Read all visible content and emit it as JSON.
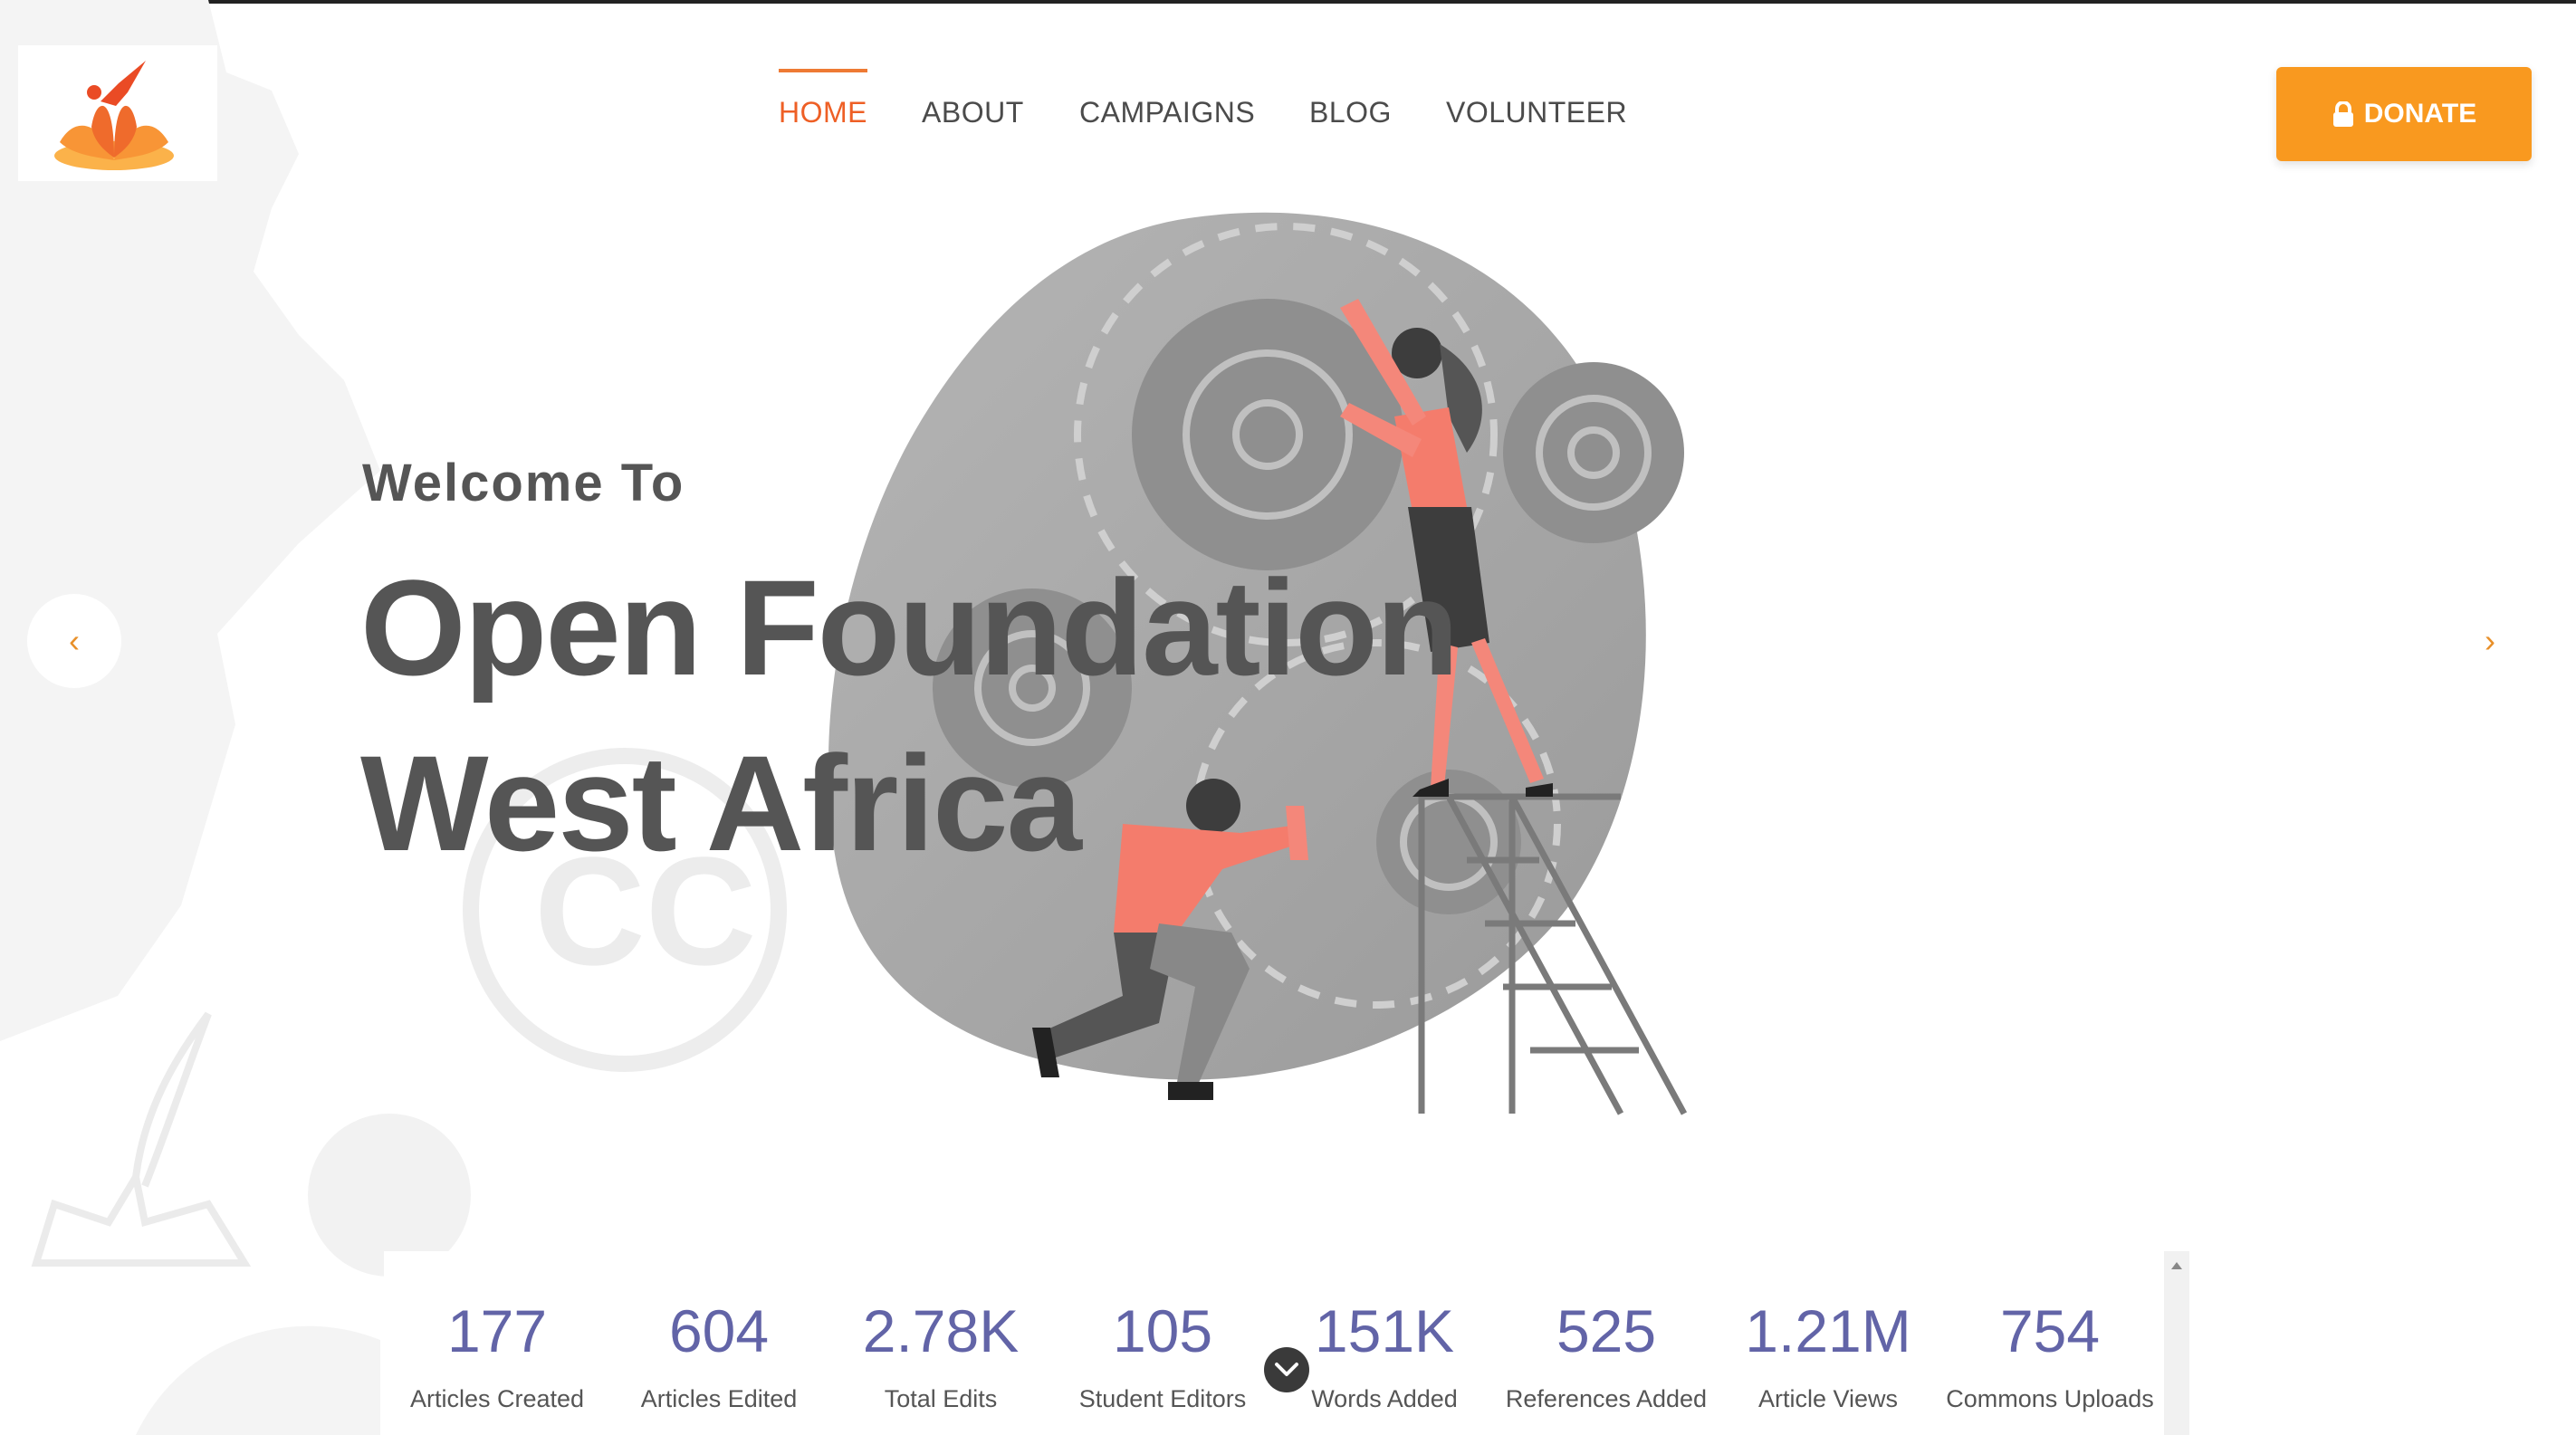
{
  "nav": {
    "items": [
      {
        "label": "HOME",
        "active": true
      },
      {
        "label": "ABOUT",
        "active": false
      },
      {
        "label": "CAMPAIGNS",
        "active": false
      },
      {
        "label": "BLOG",
        "active": false
      },
      {
        "label": "VOLUNTEER",
        "active": false
      }
    ]
  },
  "donate": {
    "label": "DONATE",
    "icon": "lock-icon"
  },
  "hero": {
    "welcome": "Welcome To",
    "title_line1": "Open Foundation",
    "title_line2": "West Africa",
    "prev_icon": "chevron-left-icon",
    "next_icon": "chevron-right-icon"
  },
  "stats": [
    {
      "value": "177",
      "label": "Articles Created"
    },
    {
      "value": "604",
      "label": "Articles Edited"
    },
    {
      "value": "2.78K",
      "label": "Total Edits"
    },
    {
      "value": "105",
      "label": "Student Editors"
    },
    {
      "value": "151K",
      "label": "Words Added"
    },
    {
      "value": "525",
      "label": "References Added"
    },
    {
      "value": "1.21M",
      "label": "Article Views"
    },
    {
      "value": "754",
      "label": "Commons Uploads"
    }
  ],
  "colors": {
    "accent": "#ee5f25",
    "donate": "#f9991f",
    "stat_value": "#6264a7",
    "text": "#555555"
  }
}
